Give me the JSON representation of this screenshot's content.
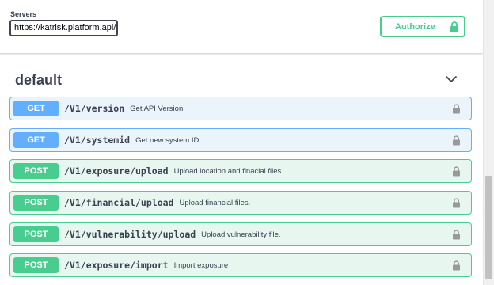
{
  "servers": {
    "label": "Servers",
    "selected": "https://katrisk.platform.api/"
  },
  "authorize": {
    "label": "Authorize",
    "icon": "lock-icon",
    "color": "#49cc90"
  },
  "tag": {
    "name": "default",
    "icon": "chevron-down-icon"
  },
  "colors": {
    "get": "#61affe",
    "post": "#49cc90",
    "get_bg": "#ebf3fb",
    "post_bg": "#e8f6f0"
  },
  "operations": [
    {
      "method": "GET",
      "path": "/V1/version",
      "summary": "Get API Version."
    },
    {
      "method": "GET",
      "path": "/V1/systemid",
      "summary": "Get new system ID."
    },
    {
      "method": "POST",
      "path": "/V1/exposure/upload",
      "summary": "Upload location and finacial files."
    },
    {
      "method": "POST",
      "path": "/V1/financial/upload",
      "summary": "Upload financial files."
    },
    {
      "method": "POST",
      "path": "/V1/vulnerability/upload",
      "summary": "Upload vulnerability file."
    },
    {
      "method": "POST",
      "path": "/V1/exposure/import",
      "summary": "Import exposure"
    }
  ]
}
